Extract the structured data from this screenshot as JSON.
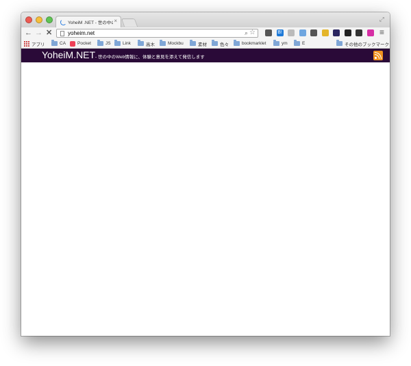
{
  "browser": {
    "tab": {
      "title": "YoheiM .NET - 世の中のWeb",
      "close": "×"
    },
    "resize": "⤢",
    "nav": {
      "back": "←",
      "forward": "→",
      "stop": "✕"
    },
    "address": {
      "url": "yoheim.net"
    },
    "menu": "≡",
    "extensions": [
      {
        "name": "pocket-ext",
        "label": "",
        "color": "#555555"
      },
      {
        "name": "hatena-ext",
        "label": "B!",
        "color": "#1e7ad8"
      },
      {
        "name": "gray-ext",
        "label": "",
        "color": "#bbbbbb"
      },
      {
        "name": "calendar-ext",
        "label": "",
        "color": "#6fa6e0"
      },
      {
        "name": "cloud-ext",
        "label": "",
        "color": "#555555"
      },
      {
        "name": "toolbox-ext",
        "label": "",
        "color": "#e4b52a"
      },
      {
        "name": "dark-ext",
        "label": "",
        "color": "#2a2560"
      },
      {
        "name": "qr-ext",
        "label": "",
        "color": "#222222"
      },
      {
        "name": "block-ext",
        "label": "",
        "color": "#333333"
      },
      {
        "name": "rainbow-ext",
        "label": "",
        "color": "#d62fa5"
      }
    ]
  },
  "bookmarks": {
    "items": [
      "アプリ",
      "CA",
      "Pocket",
      "JS",
      "Link",
      "高木",
      "Mockbu",
      "素材",
      "色々",
      "bookmarklet",
      "ym",
      "E"
    ],
    "other": "その他のブックマーク"
  },
  "site": {
    "title": "YoheiM.NET",
    "tagline": "- 世の中のWeb情報に、体験と意見を添えて発信します"
  },
  "colors": {
    "header_bg": "#2a0a38",
    "rss": "#f0911e"
  }
}
